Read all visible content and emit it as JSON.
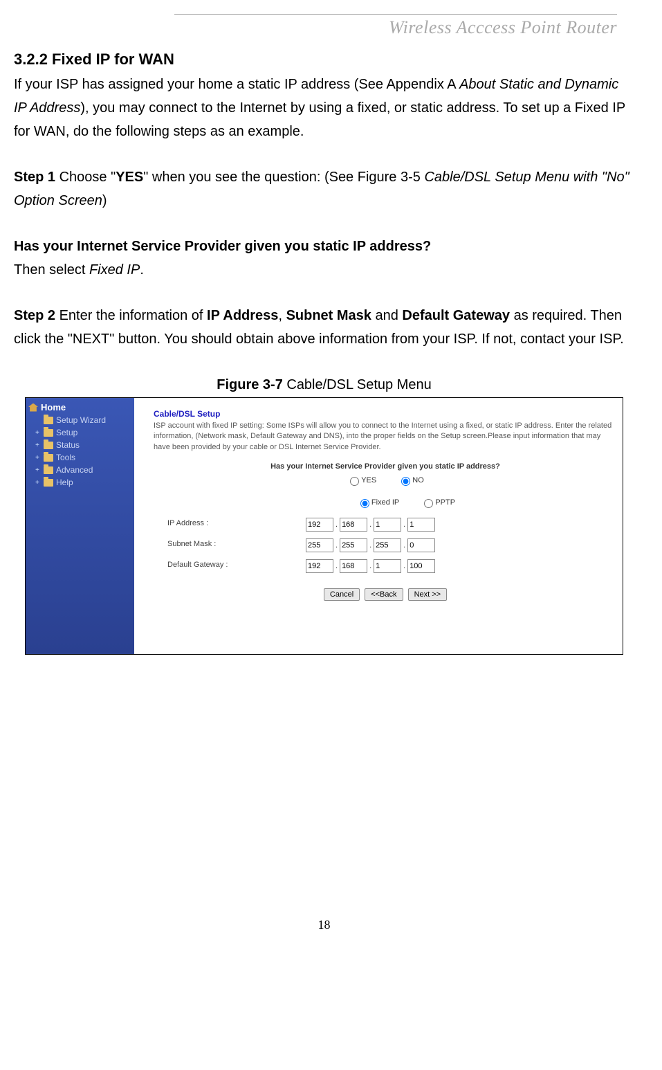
{
  "header": {
    "title": "Wireless  Acccess  Point  Router"
  },
  "section": {
    "heading": "3.2.2 Fixed IP for WAN",
    "para1_a": "If your ISP has assigned your home a static IP address (See Appendix A ",
    "para1_ital": "About Static and Dynamic IP Address",
    "para1_b": "), you may connect to the Internet by using a fixed, or static address. To set up a Fixed IP for WAN, do the following steps as an example.",
    "step1_bold": "Step 1",
    "step1_a": " Choose \"",
    "step1_yes": "YES",
    "step1_b": "\" when you see the question: (See Figure 3-5 ",
    "step1_ital": "Cable/DSL Setup Menu with \"No\" Option Screen",
    "step1_c": ")",
    "question": "Has your Internet Service Provider given you static IP address?",
    "then_a": "Then select ",
    "then_ital": "Fixed IP",
    "then_b": ".",
    "step2_bold": "Step 2",
    "step2_a": " Enter the information of ",
    "step2_ip": "IP Address",
    "step2_comma": ", ",
    "step2_sm": "Subnet Mask",
    "step2_and": " and ",
    "step2_dg": "Default Gateway",
    "step2_b": " as required. Then click the \"NEXT\" button. You should obtain above information from your ISP. If not, contact your ISP.",
    "figure_bold": "Figure 3-7",
    "figure_text": " Cable/DSL Setup Menu"
  },
  "screenshot": {
    "sidebar": {
      "home": "Home",
      "items": [
        {
          "label": "Setup Wizard",
          "plus": ""
        },
        {
          "label": "Setup",
          "plus": "+"
        },
        {
          "label": "Status",
          "plus": "+"
        },
        {
          "label": "Tools",
          "plus": "+"
        },
        {
          "label": "Advanced",
          "plus": "+"
        },
        {
          "label": "Help",
          "plus": "+"
        }
      ]
    },
    "content": {
      "title": "Cable/DSL Setup",
      "desc": "ISP account with fixed IP setting: Some ISPs will allow you to connect to the Internet using a fixed, or static IP address. Enter the related information, (Network mask, Default Gateway and DNS), into the proper fields on the Setup screen.Please input information that may have been provided by your cable or DSL Internet Service Provider.",
      "question": "Has your Internet Service Provider given you static IP address?",
      "opt_yes": "YES",
      "opt_no": "NO",
      "opt_fixed": "Fixed IP",
      "opt_pptp": "PPTP",
      "fields": {
        "ip_label": "IP Address :",
        "ip": [
          "192",
          "168",
          "1",
          "1"
        ],
        "mask_label": "Subnet Mask :",
        "mask": [
          "255",
          "255",
          "255",
          "0"
        ],
        "gw_label": "Default Gateway :",
        "gw": [
          "192",
          "168",
          "1",
          "100"
        ]
      },
      "buttons": {
        "cancel": "Cancel",
        "back": "<<Back",
        "next": "Next >>"
      }
    }
  },
  "page_number": "18"
}
